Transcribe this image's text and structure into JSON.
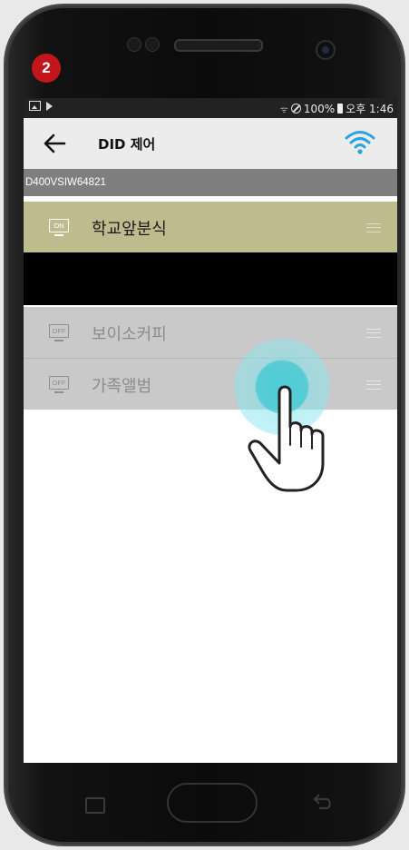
{
  "tutorial": {
    "step_number": "2"
  },
  "status_bar": {
    "battery": "100%",
    "time": "오후 1:46"
  },
  "app_bar": {
    "title": "DID 제어",
    "back_icon": "arrow-left-icon",
    "wifi_icon": "wifi-icon",
    "accent_color": "#2aa3e0"
  },
  "device": {
    "id": "D400VSIW64821"
  },
  "channels": [
    {
      "label": "학교앞분식",
      "status": "ON",
      "active": true
    },
    {
      "label": "보이소커피",
      "status": "OFF",
      "active": false
    },
    {
      "label": "가족앨범",
      "status": "OFF",
      "active": false
    }
  ],
  "colors": {
    "active_row": "#c0bb8e",
    "inactive_row": "#c9c9c9",
    "tap_highlight": "#46cdd7",
    "step_badge": "#c2161a"
  }
}
